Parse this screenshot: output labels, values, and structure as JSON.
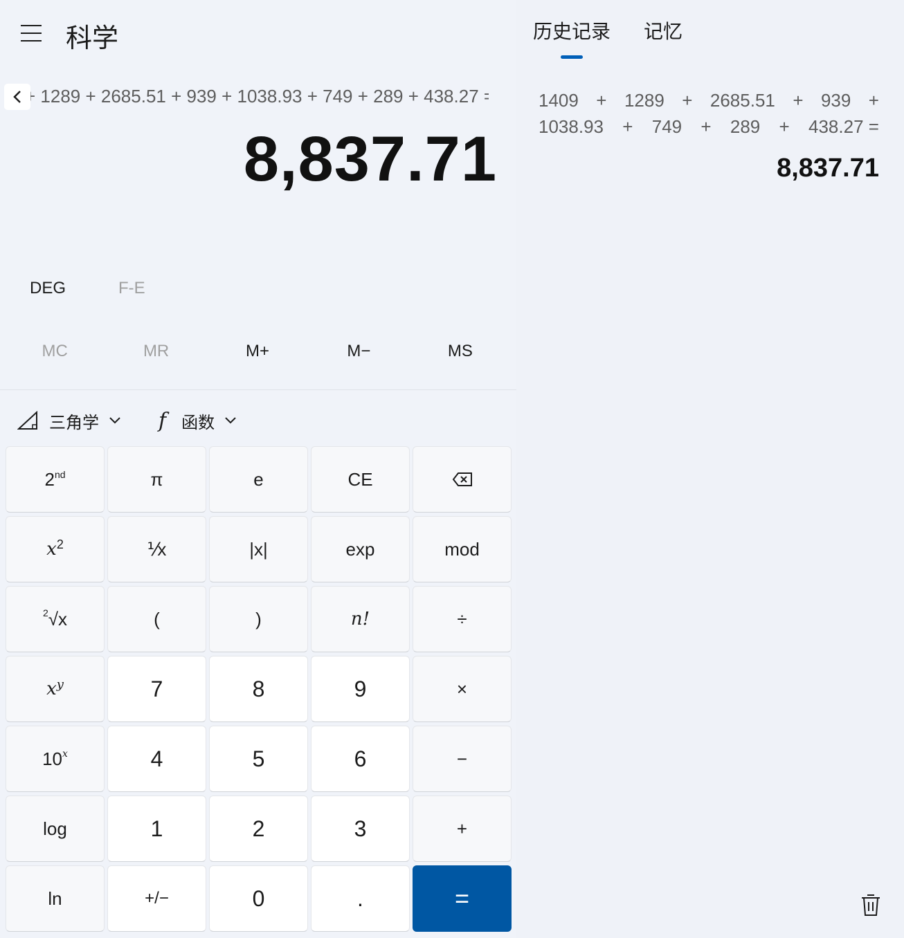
{
  "app": {
    "mode_title": "科学"
  },
  "display": {
    "expression": "+ 1289 + 2685.51 + 939 + 1038.93 + 749 + 289 + 438.27 =",
    "result": "8,837.71"
  },
  "settings": {
    "angle_unit": "DEG",
    "fe_label": "F-E"
  },
  "memory": [
    "MC",
    "MR",
    "M+",
    "M−",
    "MS"
  ],
  "functions": {
    "trig_label": "三角学",
    "func_label": "函数",
    "func_icon_text": "f"
  },
  "keys": {
    "second": "2",
    "second_sup": "nd",
    "pi": "π",
    "e": "e",
    "ce": "CE",
    "x_sq_base": "x",
    "x_sq_exp": "2",
    "reciprocal": "⅟x",
    "abs": "|x|",
    "exp": "exp",
    "mod": "mod",
    "sqrt_idx": "2",
    "sqrt_body": "√x",
    "lparen": "(",
    "rparen": ")",
    "fact": "n!",
    "divide": "÷",
    "xy_base": "x",
    "xy_exp": "y",
    "n7": "7",
    "n8": "8",
    "n9": "9",
    "multiply": "×",
    "tenx_base": "10",
    "tenx_exp": "x",
    "n4": "4",
    "n5": "5",
    "n6": "6",
    "minus": "−",
    "log": "log",
    "n1": "1",
    "n2": "2",
    "n3": "3",
    "plus": "+",
    "ln": "ln",
    "negate": "+/−",
    "n0": "0",
    "decimal": ".",
    "equals": "="
  },
  "panel": {
    "tabs": [
      "历史记录",
      "记忆"
    ],
    "history": {
      "line1": [
        "1409",
        "+",
        "1289",
        "+",
        "2685.51",
        "+",
        "939",
        "+"
      ],
      "line2": [
        "1038.93",
        "+",
        "749",
        "+",
        "289",
        "+",
        "438.27 ="
      ],
      "result": "8,837.71"
    }
  },
  "colors": {
    "accent": "#005fb8",
    "equals_bg": "#0057a3"
  }
}
